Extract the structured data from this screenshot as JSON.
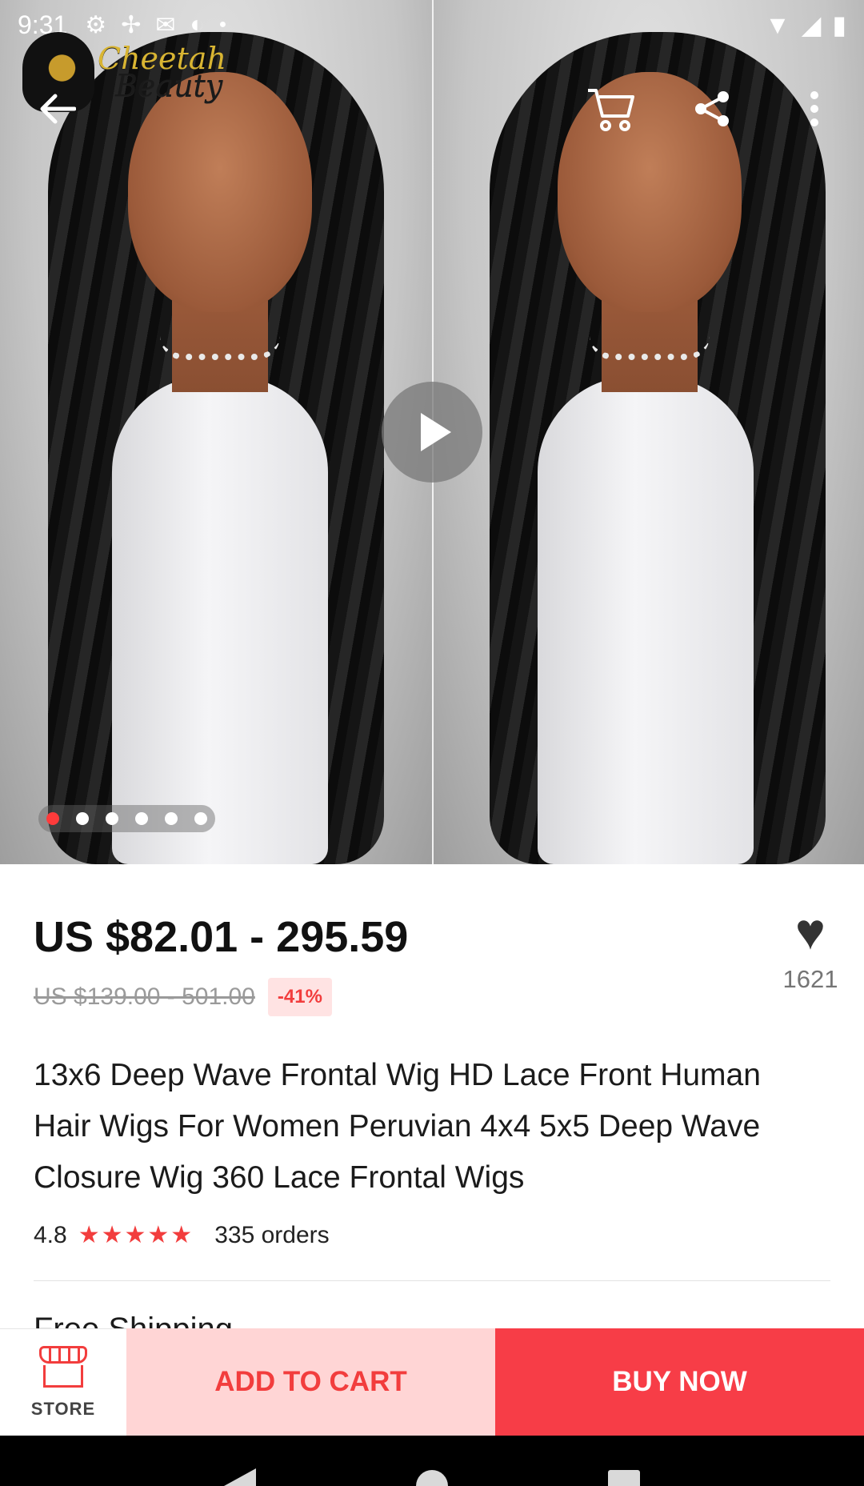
{
  "status_bar": {
    "time": "9:31",
    "icons": [
      "gear-icon",
      "fan-icon",
      "mail-icon",
      "sync-icon",
      "dot-icon"
    ],
    "right_icons": [
      "wifi-icon",
      "signal-icon",
      "battery-icon"
    ]
  },
  "brand": {
    "word1": "Cheetah",
    "word2": "Beauty"
  },
  "top_bar": {
    "icons": [
      "back-arrow-icon",
      "cart-icon",
      "share-icon",
      "more-vert-icon"
    ]
  },
  "gallery": {
    "image_count": 6,
    "active_index": 0,
    "has_video": true
  },
  "product": {
    "price": "US $82.01 - 295.59",
    "original_price": "US $139.00 - 501.00",
    "discount": "-41%",
    "wishlist_count": "1621",
    "title": "13x6 Deep Wave Frontal Wig HD Lace Front Human Hair Wigs For Women Peruvian 4x4 5x5 Deep Wave Closure Wig 360 Lace Frontal Wigs",
    "rating": "4.8",
    "stars": "★★★★★",
    "orders": "335 orders",
    "shipping": "Free Shipping"
  },
  "actions": {
    "store_label": "STORE",
    "add_to_cart": "ADD TO CART",
    "buy_now": "BUY NOW"
  },
  "colors": {
    "accent": "#f73d47",
    "cart_bg": "#ffd5d5",
    "discount_bg": "#ffe3e3"
  }
}
